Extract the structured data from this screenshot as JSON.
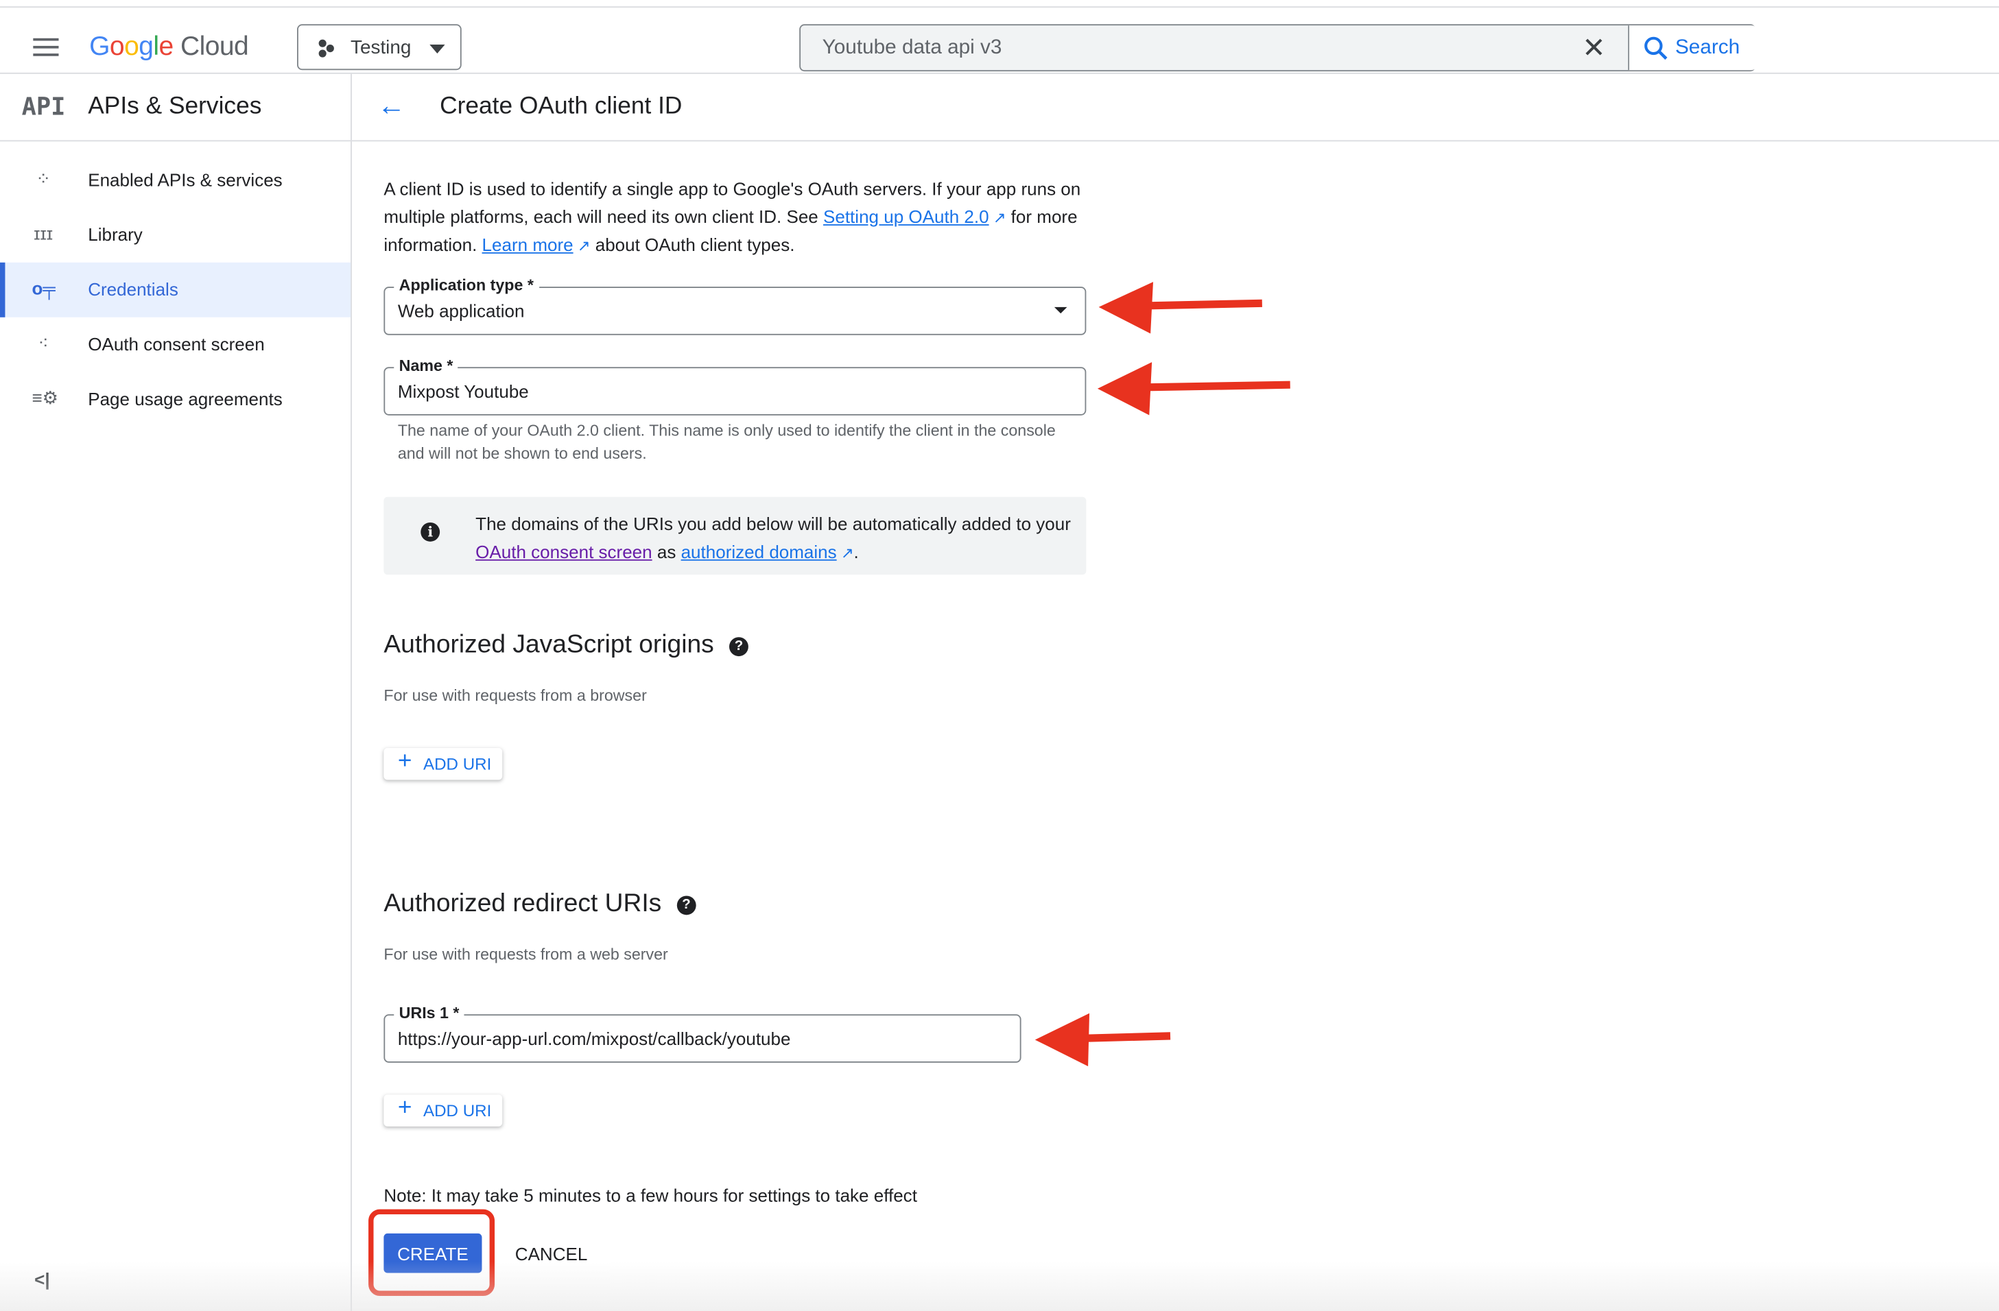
{
  "header": {
    "logo": {
      "google": "Google",
      "cloud": "Cloud"
    },
    "project": "Testing",
    "search": {
      "value": "Youtube data api v3",
      "button": "Search"
    }
  },
  "sidebar": {
    "title": "APIs & Services",
    "icon_text": "API",
    "items": [
      {
        "label": "Enabled APIs & services",
        "icon": "diamond-dots-icon"
      },
      {
        "label": "Library",
        "icon": "library-icon"
      },
      {
        "label": "Credentials",
        "icon": "key-icon",
        "active": true
      },
      {
        "label": "OAuth consent screen",
        "icon": "consent-screen-icon"
      },
      {
        "label": "Page usage agreements",
        "icon": "settings-list-icon"
      }
    ],
    "collapse": "<|"
  },
  "page": {
    "title": "Create OAuth client ID",
    "intro": {
      "t1": "A client ID is used to identify a single app to Google's OAuth servers. If your app runs on multiple platforms, each will need its own client ID. See ",
      "link1": "Setting up OAuth 2.0",
      "t2": " for more information. ",
      "link2": "Learn more",
      "t3": " about OAuth client types."
    },
    "app_type": {
      "label": "Application type *",
      "value": "Web application"
    },
    "name": {
      "label": "Name *",
      "value": "Mixpost Youtube",
      "helper": "The name of your OAuth 2.0 client. This name is only used to identify the client in the console and will not be shown to end users."
    },
    "info": {
      "t1": "The domains of the URIs you add below will be automatically added to your ",
      "link1": "OAuth consent screen",
      "t2": " as ",
      "link2": "authorized domains",
      "t3": "."
    },
    "js_origins": {
      "heading": "Authorized JavaScript origins",
      "sub": "For use with requests from a browser",
      "add": "ADD URI"
    },
    "redirect": {
      "heading": "Authorized redirect URIs",
      "sub": "For use with requests from a web server",
      "uri_label": "URIs 1 *",
      "uri_value": "https://your-app-url.com/mixpost/callback/youtube",
      "add": "ADD URI"
    },
    "note": "Note: It may take 5 minutes to a few hours for settings to take effect",
    "create": "CREATE",
    "cancel": "CANCEL"
  },
  "colors": {
    "accent": "#1a73e8",
    "primary_button": "#3367d6",
    "annotation": "#e8321f"
  }
}
